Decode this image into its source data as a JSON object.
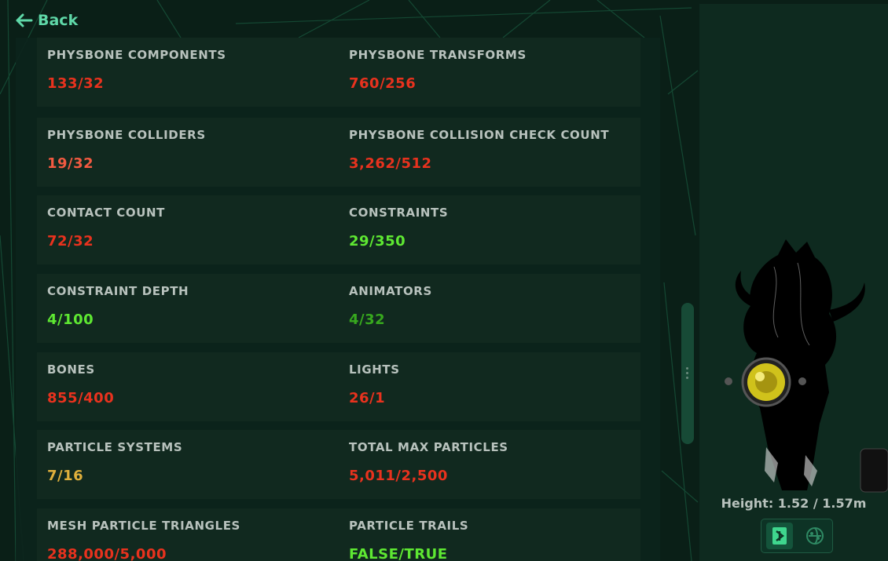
{
  "nav": {
    "back_label": "Back"
  },
  "stats": [
    {
      "left": {
        "label": "PHYSBONE COMPONENTS",
        "value": "133/32",
        "status": "red"
      },
      "right": {
        "label": "PHYSBONE TRANSFORMS",
        "value": "760/256",
        "status": "red"
      }
    },
    {
      "left": {
        "label": "PHYSBONE COLLIDERS",
        "value": "19/32",
        "status": "lightred"
      },
      "right": {
        "label": "PHYSBONE COLLISION CHECK COUNT",
        "value": "3,262/512",
        "status": "red"
      }
    },
    {
      "left": {
        "label": "CONTACT COUNT",
        "value": "72/32",
        "status": "red"
      },
      "right": {
        "label": "CONSTRAINTS",
        "value": "29/350",
        "status": "green"
      }
    },
    {
      "left": {
        "label": "CONSTRAINT DEPTH",
        "value": "4/100",
        "status": "green"
      },
      "right": {
        "label": "ANIMATORS",
        "value": "4/32",
        "status": "darkgreen"
      }
    },
    {
      "left": {
        "label": "BONES",
        "value": "855/400",
        "status": "red"
      },
      "right": {
        "label": "LIGHTS",
        "value": "26/1",
        "status": "red"
      }
    },
    {
      "left": {
        "label": "PARTICLE SYSTEMS",
        "value": "7/16",
        "status": "yellow"
      },
      "right": {
        "label": "TOTAL MAX PARTICLES",
        "value": "5,011/2,500",
        "status": "red"
      }
    },
    {
      "left": {
        "label": "MESH PARTICLE TRIANGLES",
        "value": "288,000/5,000",
        "status": "red"
      },
      "right": {
        "label": "PARTICLE TRAILS",
        "value": "FALSE/TRUE",
        "status": "green"
      }
    }
  ],
  "preview": {
    "height_text": "Height: 1.52 / 1.57m",
    "toggles": [
      {
        "icon": "pc-platform-icon",
        "active": true
      },
      {
        "icon": "quest-platform-icon",
        "active": false
      }
    ]
  },
  "colors": {
    "red": "#e8321e",
    "lightred": "#f25a41",
    "green": "#5ee832",
    "darkgreen": "#37a81e",
    "yellow": "#e0b03c",
    "accent": "#5fd8a8"
  }
}
